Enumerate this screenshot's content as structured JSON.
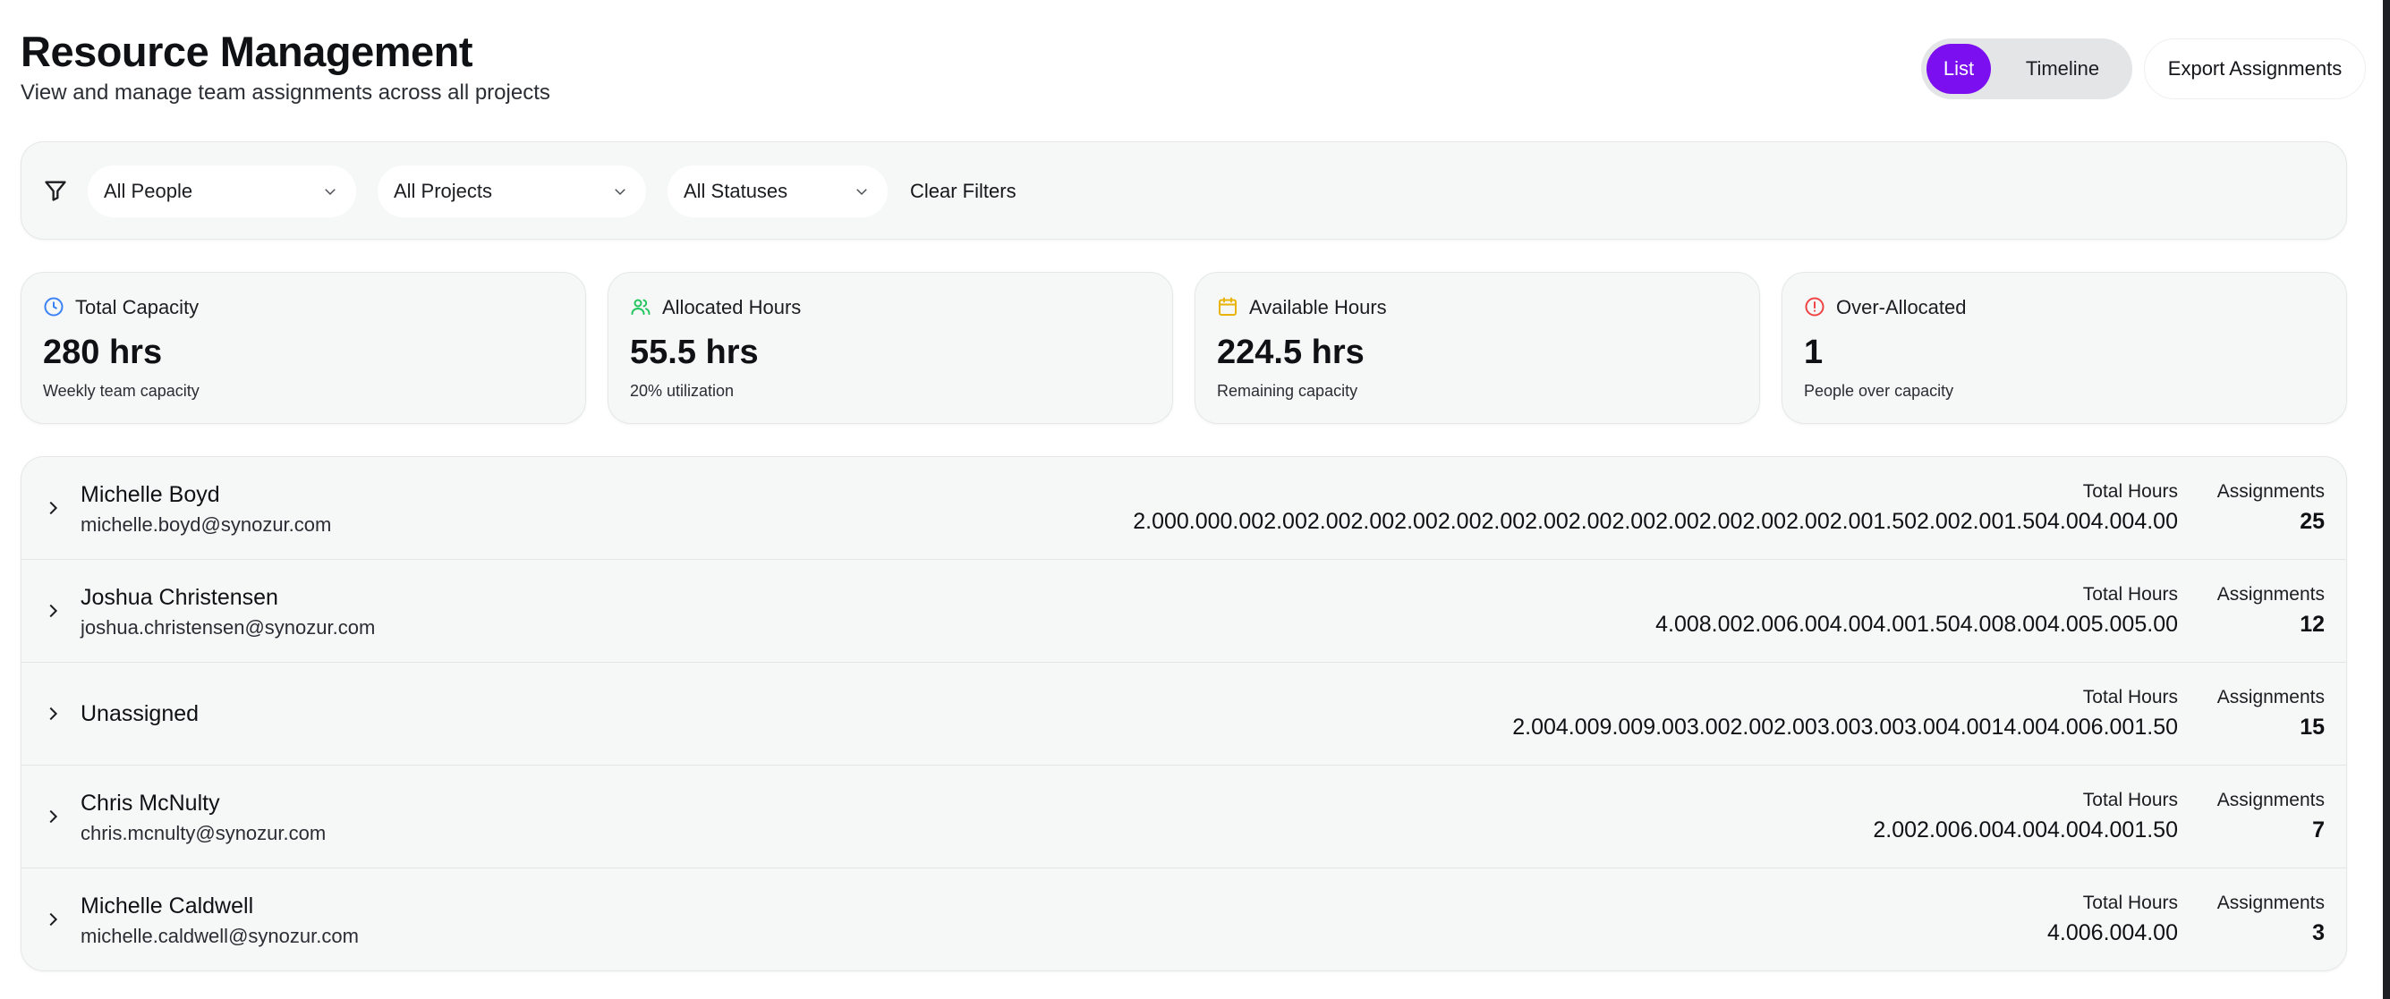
{
  "header": {
    "title": "Resource Management",
    "subtitle": "View and manage team assignments across all projects",
    "view_toggle": {
      "list_label": "List",
      "timeline_label": "Timeline",
      "active": "List"
    },
    "export_label": "Export Assignments"
  },
  "filters": {
    "people": "All People",
    "projects": "All Projects",
    "statuses": "All Statuses",
    "clear_label": "Clear Filters"
  },
  "stats": [
    {
      "label": "Total Capacity",
      "value": "280 hrs",
      "sub": "Weekly team capacity",
      "icon": "clock-icon",
      "color": "#3b82f6"
    },
    {
      "label": "Allocated Hours",
      "value": "55.5 hrs",
      "sub": "20% utilization",
      "icon": "users-icon",
      "color": "#22c55e"
    },
    {
      "label": "Available Hours",
      "value": "224.5 hrs",
      "sub": "Remaining capacity",
      "icon": "calendar-icon",
      "color": "#eab308"
    },
    {
      "label": "Over-Allocated",
      "value": "1",
      "sub": "People over capacity",
      "icon": "alert-circle-icon",
      "color": "#ef4444"
    }
  ],
  "people": [
    {
      "name": "Michelle Boyd",
      "email": "michelle.boyd@synozur.com",
      "hours_label": "Total Hours",
      "hours": "2.000.000.002.002.002.002.002.002.002.002.002.002.002.002.002.002.001.502.002.001.504.004.004.00",
      "assign_label": "Assignments",
      "assignments": "25"
    },
    {
      "name": "Joshua Christensen",
      "email": "joshua.christensen@synozur.com",
      "hours_label": "Total Hours",
      "hours": "4.008.002.006.004.004.001.504.008.004.005.005.00",
      "assign_label": "Assignments",
      "assignments": "12"
    },
    {
      "name": "Unassigned",
      "email": "",
      "hours_label": "Total Hours",
      "hours": "2.004.009.009.003.002.002.003.003.003.004.0014.004.006.001.50",
      "assign_label": "Assignments",
      "assignments": "15"
    },
    {
      "name": "Chris McNulty",
      "email": "chris.mcnulty@synozur.com",
      "hours_label": "Total Hours",
      "hours": "2.002.006.004.004.004.001.50",
      "assign_label": "Assignments",
      "assignments": "7"
    },
    {
      "name": "Michelle Caldwell",
      "email": "michelle.caldwell@synozur.com",
      "hours_label": "Total Hours",
      "hours": "4.006.004.00",
      "assign_label": "Assignments",
      "assignments": "3"
    }
  ]
}
